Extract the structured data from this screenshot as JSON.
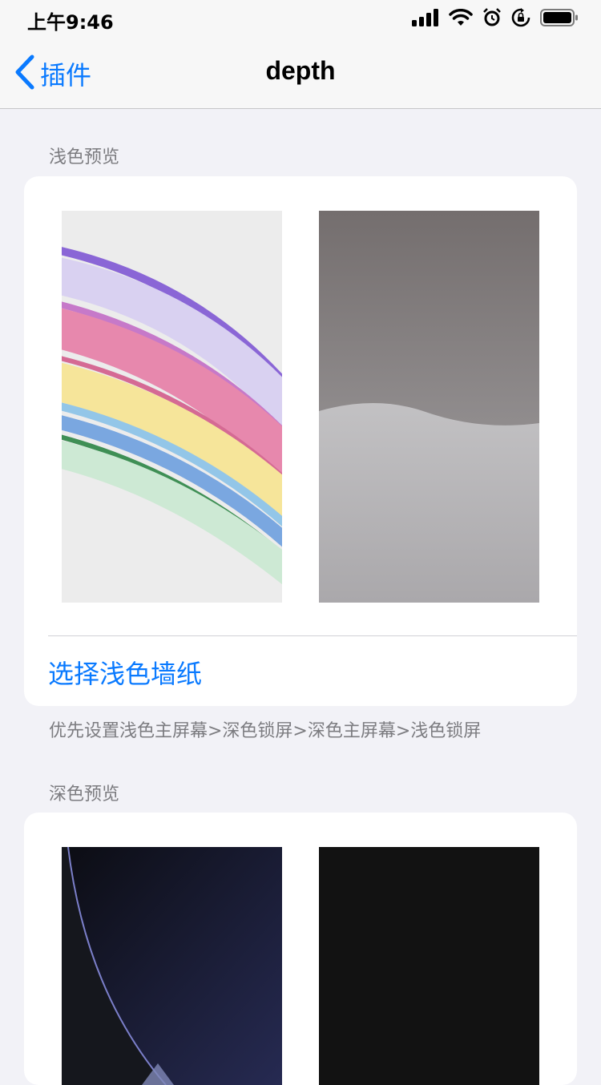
{
  "status_bar": {
    "time": "上午9:46",
    "icons": [
      "signal-icon",
      "wifi-icon",
      "alarm-icon",
      "rotation-lock-icon",
      "battery-icon"
    ]
  },
  "nav": {
    "back_label": "插件",
    "title": "depth"
  },
  "light_section": {
    "header": "浅色预览",
    "thumbnails": [
      "light-home-wallpaper",
      "light-lock-wallpaper"
    ],
    "select_label": "选择浅色墙纸",
    "footer": "优先设置浅色主屏幕>深色锁屏>深色主屏幕>浅色锁屏"
  },
  "dark_section": {
    "header": "深色预览",
    "thumbnails": [
      "dark-home-wallpaper",
      "dark-lock-wallpaper"
    ]
  },
  "colors": {
    "accent": "#0a7aff",
    "background": "#f2f2f7",
    "secondary_text": "#7c7c80"
  }
}
